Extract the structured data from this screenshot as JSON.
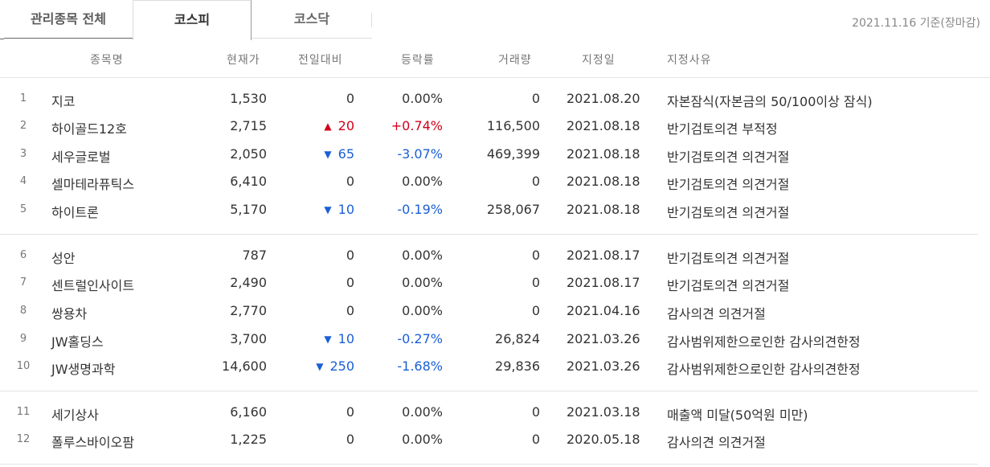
{
  "tabs": [
    {
      "label": "관리종목 전체"
    },
    {
      "label": "코스피"
    },
    {
      "label": "코스닥"
    }
  ],
  "basis_text": "2021.11.16 기준(장마감)",
  "columns": [
    "종목명",
    "현재가",
    "전일대비",
    "등락률",
    "거래량",
    "지정일",
    "지정사유"
  ],
  "rows": [
    {
      "no": "1",
      "name": "지코",
      "price": "1,530",
      "change": "0",
      "dir": "none",
      "rate": "0.00%",
      "volume": "0",
      "date": "2021.08.20",
      "reason": "자본잠식(자본금의 50/100이상 잠식)"
    },
    {
      "no": "2",
      "name": "하이골드12호",
      "price": "2,715",
      "change": "20",
      "dir": "up",
      "rate": "+0.74%",
      "volume": "116,500",
      "date": "2021.08.18",
      "reason": "반기검토의견 부적정"
    },
    {
      "no": "3",
      "name": "세우글로벌",
      "price": "2,050",
      "change": "65",
      "dir": "down",
      "rate": "-3.07%",
      "volume": "469,399",
      "date": "2021.08.18",
      "reason": "반기검토의견 의견거절"
    },
    {
      "no": "4",
      "name": "셀마테라퓨틱스",
      "price": "6,410",
      "change": "0",
      "dir": "none",
      "rate": "0.00%",
      "volume": "0",
      "date": "2021.08.18",
      "reason": "반기검토의견 의견거절"
    },
    {
      "no": "5",
      "name": "하이트론",
      "price": "5,170",
      "change": "10",
      "dir": "down",
      "rate": "-0.19%",
      "volume": "258,067",
      "date": "2021.08.18",
      "reason": "반기검토의견 의견거절"
    },
    {
      "no": "6",
      "name": "성안",
      "price": "787",
      "change": "0",
      "dir": "none",
      "rate": "0.00%",
      "volume": "0",
      "date": "2021.08.17",
      "reason": "반기검토의견 의견거절"
    },
    {
      "no": "7",
      "name": "센트럴인사이트",
      "price": "2,490",
      "change": "0",
      "dir": "none",
      "rate": "0.00%",
      "volume": "0",
      "date": "2021.08.17",
      "reason": "반기검토의견 의견거절"
    },
    {
      "no": "8",
      "name": "쌍용차",
      "price": "2,770",
      "change": "0",
      "dir": "none",
      "rate": "0.00%",
      "volume": "0",
      "date": "2021.04.16",
      "reason": "감사의견 의견거절"
    },
    {
      "no": "9",
      "name": "JW홀딩스",
      "price": "3,700",
      "change": "10",
      "dir": "down",
      "rate": "-0.27%",
      "volume": "26,824",
      "date": "2021.03.26",
      "reason": "감사범위제한으로인한 감사의견한정"
    },
    {
      "no": "10",
      "name": "JW생명과학",
      "price": "14,600",
      "change": "250",
      "dir": "down",
      "rate": "-1.68%",
      "volume": "29,836",
      "date": "2021.03.26",
      "reason": "감사범위제한으로인한 감사의견한정"
    },
    {
      "no": "11",
      "name": "세기상사",
      "price": "6,160",
      "change": "0",
      "dir": "none",
      "rate": "0.00%",
      "volume": "0",
      "date": "2021.03.18",
      "reason": "매출액 미달(50억원 미만)"
    },
    {
      "no": "12",
      "name": "폴루스바이오팜",
      "price": "1,225",
      "change": "0",
      "dir": "none",
      "rate": "0.00%",
      "volume": "0",
      "date": "2020.05.18",
      "reason": "감사의견 의견거절"
    }
  ],
  "colors": {
    "up": "#d0021b",
    "down": "#1a5fd6"
  },
  "icons": {
    "up": "triangle-up-icon",
    "down": "triangle-down-icon"
  }
}
